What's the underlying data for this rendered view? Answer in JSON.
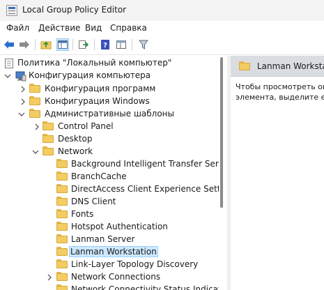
{
  "window": {
    "title": "Local Group Policy Editor"
  },
  "menu": [
    "Файл",
    "Действие",
    "Вид",
    "Справка"
  ],
  "toolbar": {
    "buttons": [
      "back-icon",
      "forward-icon",
      "up-folder-icon",
      "show-hide-tree-icon",
      "export-list-icon",
      "help-icon",
      "console-properties-icon",
      "filter-icon"
    ],
    "active": "show-hide-tree-icon"
  },
  "tree": {
    "root": "Политика \"Локальный компьютер\"",
    "computer_config": "Конфигурация компьютера",
    "software_settings": "Конфигурация программ",
    "windows_settings": "Конфигурация Windows",
    "admin_templates": "Административные шаблоны",
    "control_panel": "Control Panel",
    "desktop": "Desktop",
    "network": "Network",
    "network_children": [
      "Background Intelligent Transfer Service",
      "BranchCache",
      "DirectAccess Client Experience Settings",
      "DNS Client",
      "Fonts",
      "Hotspot Authentication",
      "Lanman Server",
      "Lanman Workstation",
      "Link-Layer Topology Discovery",
      "Network Connections",
      "Network Connectivity Status Indicator"
    ],
    "selected": "Lanman Workstation"
  },
  "details": {
    "title": "Lanman Workstatio",
    "description_line1": "Чтобы просмотреть оп",
    "description_line2": "элемента, выделите его"
  },
  "colors": {
    "selection": "#cce8ff",
    "header": "#d9dde2",
    "folder": "#f3cc62"
  }
}
